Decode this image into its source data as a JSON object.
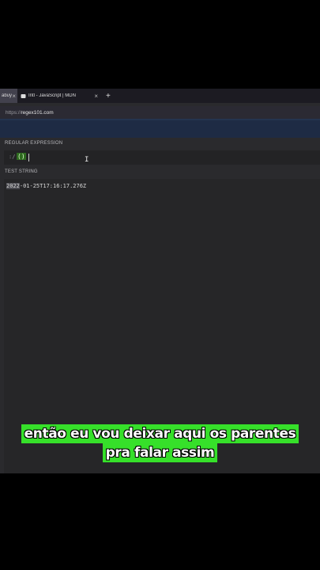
{
  "browser": {
    "tabs": [
      {
        "label": "abuy",
        "active": true,
        "close": "×"
      },
      {
        "label": "Intl - JavaScript | MDN",
        "active": false,
        "close": "×"
      }
    ],
    "new_tab": "+",
    "url_scheme": "https://",
    "url_host": "regex101.com"
  },
  "regex101": {
    "regex_label": "REGULAR EXPRESSION",
    "regex_delimiter": ":/",
    "regex_value": "()",
    "test_label": "TEST STRING",
    "test_match": "2022",
    "test_rest": "-01-25T17:16:17.276Z"
  },
  "subtitles": {
    "line1": "então eu vou deixar aqui os parentes",
    "line2": "pra falar assim"
  },
  "colors": {
    "caption_bg": "#36e02a",
    "header_bg": "#1e2b44",
    "match_bg": "#2e6a1f"
  }
}
